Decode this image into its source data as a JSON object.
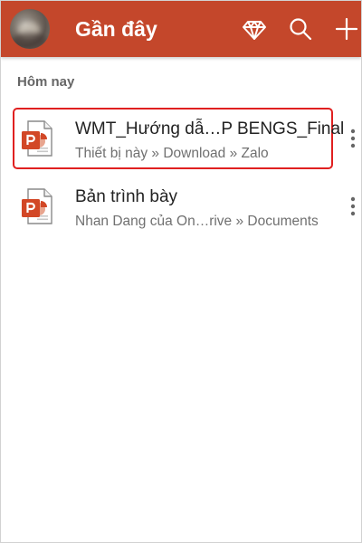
{
  "header": {
    "title": "Gần đây",
    "avatar_icon": "user-avatar",
    "actions": [
      {
        "name": "premium-diamond-icon",
        "icon": "diamond"
      },
      {
        "name": "search-icon",
        "icon": "magnifier"
      },
      {
        "name": "add-icon",
        "icon": "plus"
      }
    ]
  },
  "section": {
    "label": "Hôm nay"
  },
  "files": [
    {
      "name": "WMT_Hướng dẫ…P BENGS_Final",
      "path": "Thiết bị này » Download » Zalo",
      "icon": "powerpoint-file-icon",
      "selected": true
    },
    {
      "name": "Bản trình bày",
      "path": "Nhan Dang của On…rive » Documents",
      "icon": "powerpoint-file-icon",
      "selected": false
    }
  ],
  "colors": {
    "header": "#c4472b",
    "selection_border": "#e02020",
    "ppt_orange": "#d24726"
  }
}
